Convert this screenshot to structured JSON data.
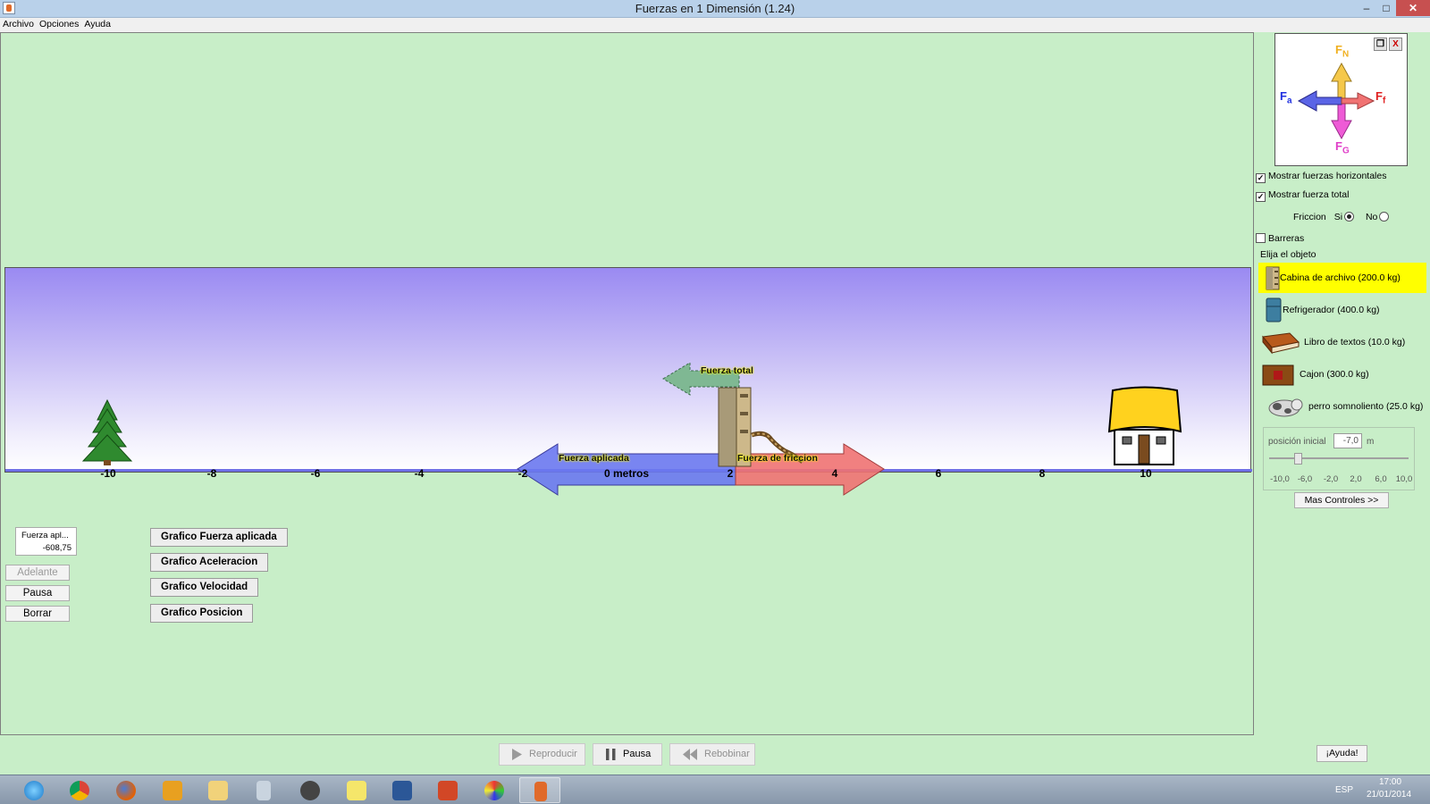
{
  "window": {
    "title": "Fuerzas en 1 Dimensión (1.24)",
    "min": "–",
    "max": "□",
    "close": "✕"
  },
  "menu": [
    "Archivo",
    "Opciones",
    "Ayuda"
  ],
  "scene": {
    "axis_ticks": [
      "-10",
      "-8",
      "-6",
      "-4",
      "-2",
      "0 metros",
      "2",
      "4",
      "6",
      "8",
      "10"
    ],
    "labels": {
      "total": "Fuerza total",
      "applied": "Fuerza aplicada",
      "friction": "Fuerza de friccion"
    },
    "icons": [
      "tree-icon",
      "house-icon",
      "filing-cabinet-icon",
      "person-pushing-icon"
    ]
  },
  "readout": {
    "label": "Fuerza apl...",
    "value": "-608,75"
  },
  "sim_buttons": {
    "forward": "Adelante",
    "pause": "Pausa",
    "clear": "Borrar"
  },
  "graph_buttons": [
    "Grafico Fuerza aplicada",
    "Grafico Aceleracion",
    "Grafico Velocidad",
    "Grafico Posicion"
  ],
  "fbd": {
    "normal": "F",
    "normal_sub": "N",
    "applied": "F",
    "applied_sub": "a",
    "friction": "F",
    "friction_sub": "f",
    "gravity": "F",
    "gravity_sub": "G",
    "restore": "❐",
    "close": "X"
  },
  "options": {
    "show_horizontal": {
      "label": "Mostrar fuerzas horizontales",
      "checked": true
    },
    "show_total": {
      "label": "Mostrar fuerza total",
      "checked": true
    },
    "friction": {
      "label": "Friccion",
      "yes": "Si",
      "no": "No",
      "selected": "Si"
    },
    "barriers": {
      "label": "Barreras",
      "checked": false
    },
    "choose_object": "Elija el objeto"
  },
  "objects": [
    {
      "label": "Cabina de archivo (200.0 kg)",
      "icon": "filing-cabinet-icon",
      "selected": true
    },
    {
      "label": "Refrigerador (400.0 kg)",
      "icon": "refrigerator-icon",
      "selected": false
    },
    {
      "label": "Libro de textos (10.0 kg)",
      "icon": "book-icon",
      "selected": false
    },
    {
      "label": "Cajon (300.0 kg)",
      "icon": "crate-icon",
      "selected": false
    },
    {
      "label": "perro somnoliento (25.0 kg)",
      "icon": "dog-icon",
      "selected": false
    }
  ],
  "initial_position": {
    "label": "posición inicial",
    "value": "-7,0",
    "unit": "m",
    "slider_value": -7.0,
    "ticks": [
      "-10,0",
      "-6,0",
      "-2,0",
      "2,0",
      "6,0",
      "10,0"
    ]
  },
  "more_controls": "Mas Controles >>",
  "playback": {
    "play": "Reproducir",
    "pause": "Pausa",
    "rewind": "Rebobinar"
  },
  "help": "¡Ayuda!",
  "taskbar": {
    "apps": [
      "ie-icon",
      "chrome-icon",
      "firefox-icon",
      "tool-icon",
      "folder-icon",
      "calculator-icon",
      "game-icon",
      "sticky-notes-icon",
      "word-icon",
      "powerpoint-icon",
      "paint-icon",
      "java-icon"
    ],
    "lang": "ESP",
    "time": "17:00",
    "date": "21/01/2014"
  },
  "colors": {
    "background": "#c8eec8",
    "applied": "#6a78f0",
    "friction": "#f07272",
    "total": "#7fb893",
    "selected": "#ffff00"
  }
}
